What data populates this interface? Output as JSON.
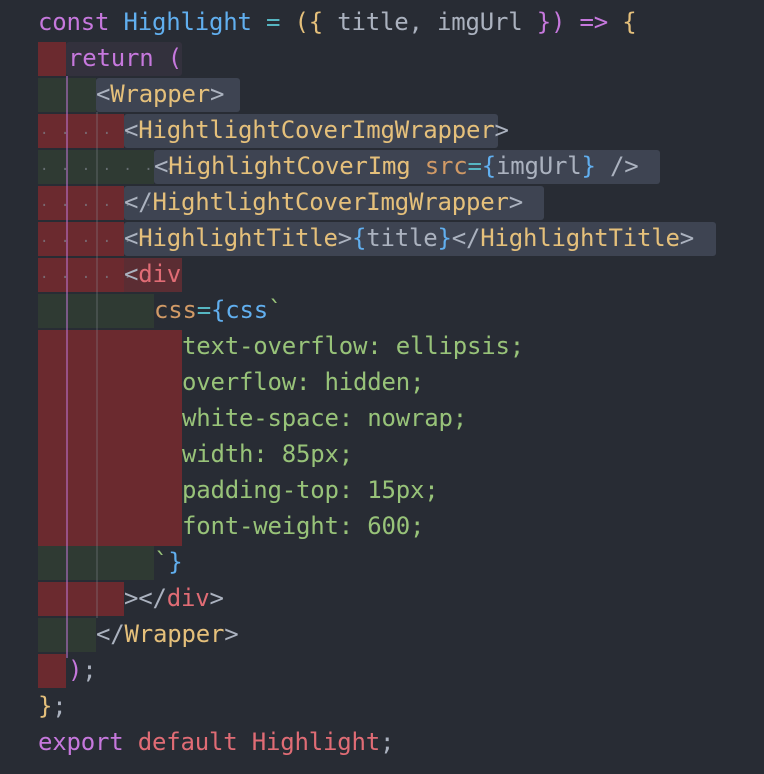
{
  "editor": {
    "lines": [
      {
        "kw": "const",
        "name": "Highlight",
        "eq": "=",
        "params_open": "({",
        "params": "title, imgUrl",
        "params_close": "})",
        "arrow": "=>",
        "brace": "{"
      },
      {
        "kw": "return",
        "paren": "("
      },
      {
        "open": "<",
        "tag": "Wrapper",
        "close": ">"
      },
      {
        "open": "<",
        "tag": "HightlightCoverImgWrapper",
        "close": ">"
      },
      {
        "open": "<",
        "tag": "HighlightCoverImg",
        "attr": "src",
        "eq": "=",
        "lb": "{",
        "val": "imgUrl",
        "rb": "}",
        "selfclose": "/>"
      },
      {
        "open": "</",
        "tag": "HightlightCoverImgWrapper",
        "close": ">"
      },
      {
        "open": "<",
        "tag": "HighlightTitle",
        "close1": ">",
        "lb": "{",
        "val": "title",
        "rb": "}",
        "open2": "</",
        "tag2": "HighlightTitle",
        "close2": ">"
      },
      {
        "open": "<",
        "tag": "div"
      },
      {
        "attr": "css",
        "eq": "=",
        "lb": "{",
        "fn": "css",
        "tick": "`"
      },
      {
        "text": "text-overflow: ellipsis;"
      },
      {
        "text": "overflow: hidden;"
      },
      {
        "text": "white-space: nowrap;"
      },
      {
        "text": "width: 85px;"
      },
      {
        "text": "padding-top: 15px;"
      },
      {
        "text": "font-weight: 600;"
      },
      {
        "tick": "`",
        "rb": "}"
      },
      {
        "close1": ">",
        "open2": "</",
        "tag": "div",
        "close2": ">"
      },
      {
        "open": "</",
        "tag": "Wrapper",
        "close": ">"
      },
      {
        "paren": ")",
        "semi": ";"
      },
      {
        "brace": "}",
        "semi": ";"
      },
      {
        "kw1": "export",
        "kw2": "default",
        "name": "Highlight",
        "semi": ";"
      }
    ]
  }
}
